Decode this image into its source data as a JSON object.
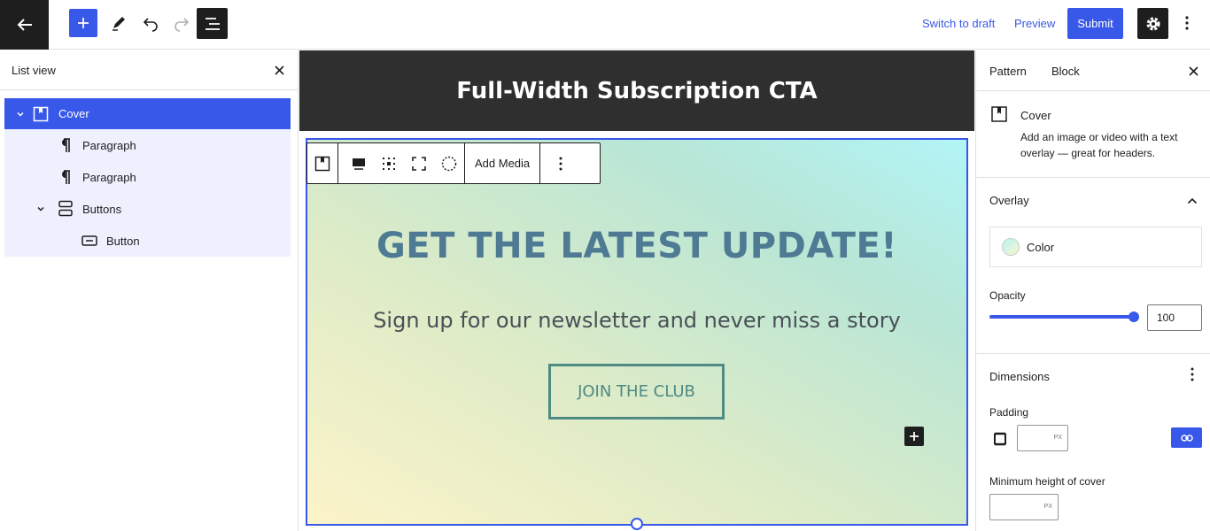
{
  "topbar": {
    "switch_to_draft": "Switch to draft",
    "preview": "Preview",
    "submit": "Submit"
  },
  "listview": {
    "title": "List view",
    "items": [
      {
        "label": "Cover",
        "icon": "cover-block-icon",
        "selected": true
      },
      {
        "label": "Paragraph",
        "icon": "paragraph-icon"
      },
      {
        "label": "Paragraph",
        "icon": "paragraph-icon"
      },
      {
        "label": "Buttons",
        "icon": "buttons-block-icon"
      },
      {
        "label": "Button",
        "icon": "button-block-icon"
      }
    ]
  },
  "canvas": {
    "post_title": "Full-Width Subscription CTA",
    "toolbar": {
      "add_media": "Add Media"
    },
    "cover": {
      "heading": "GET THE LATEST UPDATE!",
      "subheading": "Sign up for our newsletter and never miss a story",
      "button": "JOIN THE CLUB"
    }
  },
  "sidebar": {
    "tabs": [
      "Pattern",
      "Block"
    ],
    "block": {
      "name": "Cover",
      "description": "Add an image or video with a text overlay — great for headers."
    },
    "overlay": {
      "title": "Overlay",
      "color_label": "Color",
      "opacity_label": "Opacity",
      "opacity_value": "100",
      "opacity": 1.0
    },
    "dimensions": {
      "title": "Dimensions",
      "padding_label": "Padding",
      "padding_unit": "PX",
      "min_height_label": "Minimum height of cover",
      "min_height_unit": "PX"
    }
  },
  "colors": {
    "accent": "#3858e9",
    "dark": "#1e1e1e",
    "heading": "#4e7a93",
    "button": "#4f8a84"
  }
}
